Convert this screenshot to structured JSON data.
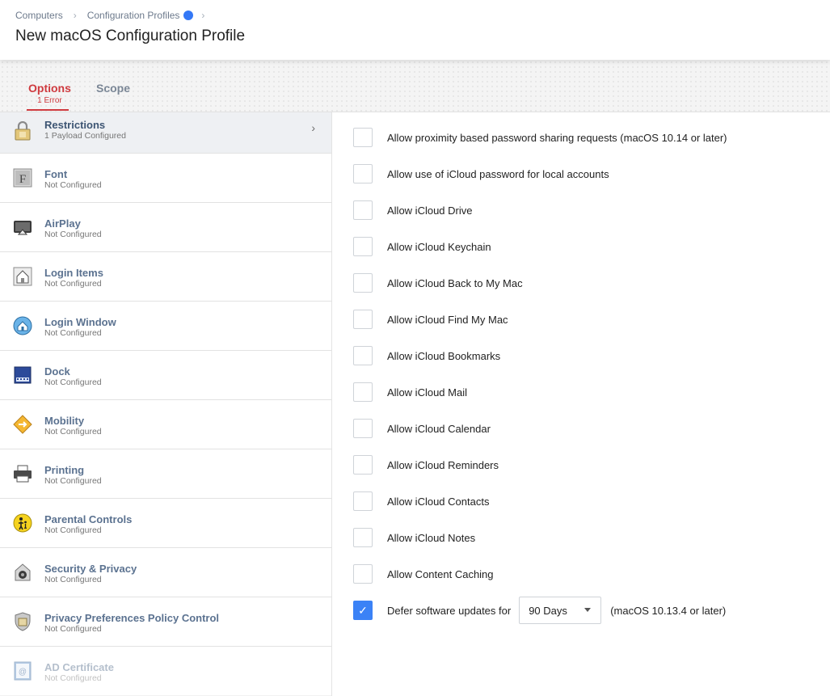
{
  "breadcrumb": {
    "item1": "Computers",
    "item2": "Configuration Profiles",
    "dot_color": "#3478f6"
  },
  "page_title": "New macOS Configuration Profile",
  "tabs": {
    "options": {
      "label": "Options",
      "error": "1 Error"
    },
    "scope": {
      "label": "Scope"
    }
  },
  "sidebar": {
    "items": [
      {
        "name": "Restrictions",
        "status": "1 Payload Configured",
        "icon": "lock-icon"
      },
      {
        "name": "Font",
        "status": "Not Configured",
        "icon": "font-icon"
      },
      {
        "name": "AirPlay",
        "status": "Not Configured",
        "icon": "airplay-icon"
      },
      {
        "name": "Login Items",
        "status": "Not Configured",
        "icon": "login-items-icon"
      },
      {
        "name": "Login Window",
        "status": "Not Configured",
        "icon": "login-window-icon"
      },
      {
        "name": "Dock",
        "status": "Not Configured",
        "icon": "dock-icon"
      },
      {
        "name": "Mobility",
        "status": "Not Configured",
        "icon": "mobility-icon"
      },
      {
        "name": "Printing",
        "status": "Not Configured",
        "icon": "printer-icon"
      },
      {
        "name": "Parental Controls",
        "status": "Not Configured",
        "icon": "parental-controls-icon"
      },
      {
        "name": "Security & Privacy",
        "status": "Not Configured",
        "icon": "security-icon"
      },
      {
        "name": "Privacy Preferences Policy Control",
        "status": "Not Configured",
        "icon": "shield-icon"
      },
      {
        "name": "AD Certificate",
        "status": "Not Configured",
        "icon": "certificate-icon"
      }
    ]
  },
  "options": [
    {
      "label": "Allow proximity based password sharing requests (macOS 10.14 or later)",
      "checked": false
    },
    {
      "label": "Allow use of iCloud password for local accounts",
      "checked": false
    },
    {
      "label": "Allow iCloud Drive",
      "checked": false
    },
    {
      "label": "Allow iCloud Keychain",
      "checked": false
    },
    {
      "label": "Allow iCloud Back to My Mac",
      "checked": false
    },
    {
      "label": "Allow iCloud Find My Mac",
      "checked": false
    },
    {
      "label": "Allow iCloud Bookmarks",
      "checked": false
    },
    {
      "label": "Allow iCloud Mail",
      "checked": false
    },
    {
      "label": "Allow iCloud Calendar",
      "checked": false
    },
    {
      "label": "Allow iCloud Reminders",
      "checked": false
    },
    {
      "label": "Allow iCloud Contacts",
      "checked": false
    },
    {
      "label": "Allow iCloud Notes",
      "checked": false
    },
    {
      "label": "Allow Content Caching",
      "checked": false
    }
  ],
  "defer": {
    "label": "Defer software updates for",
    "checked": true,
    "select_value": "90 Days",
    "note": "(macOS 10.13.4 or later)"
  }
}
